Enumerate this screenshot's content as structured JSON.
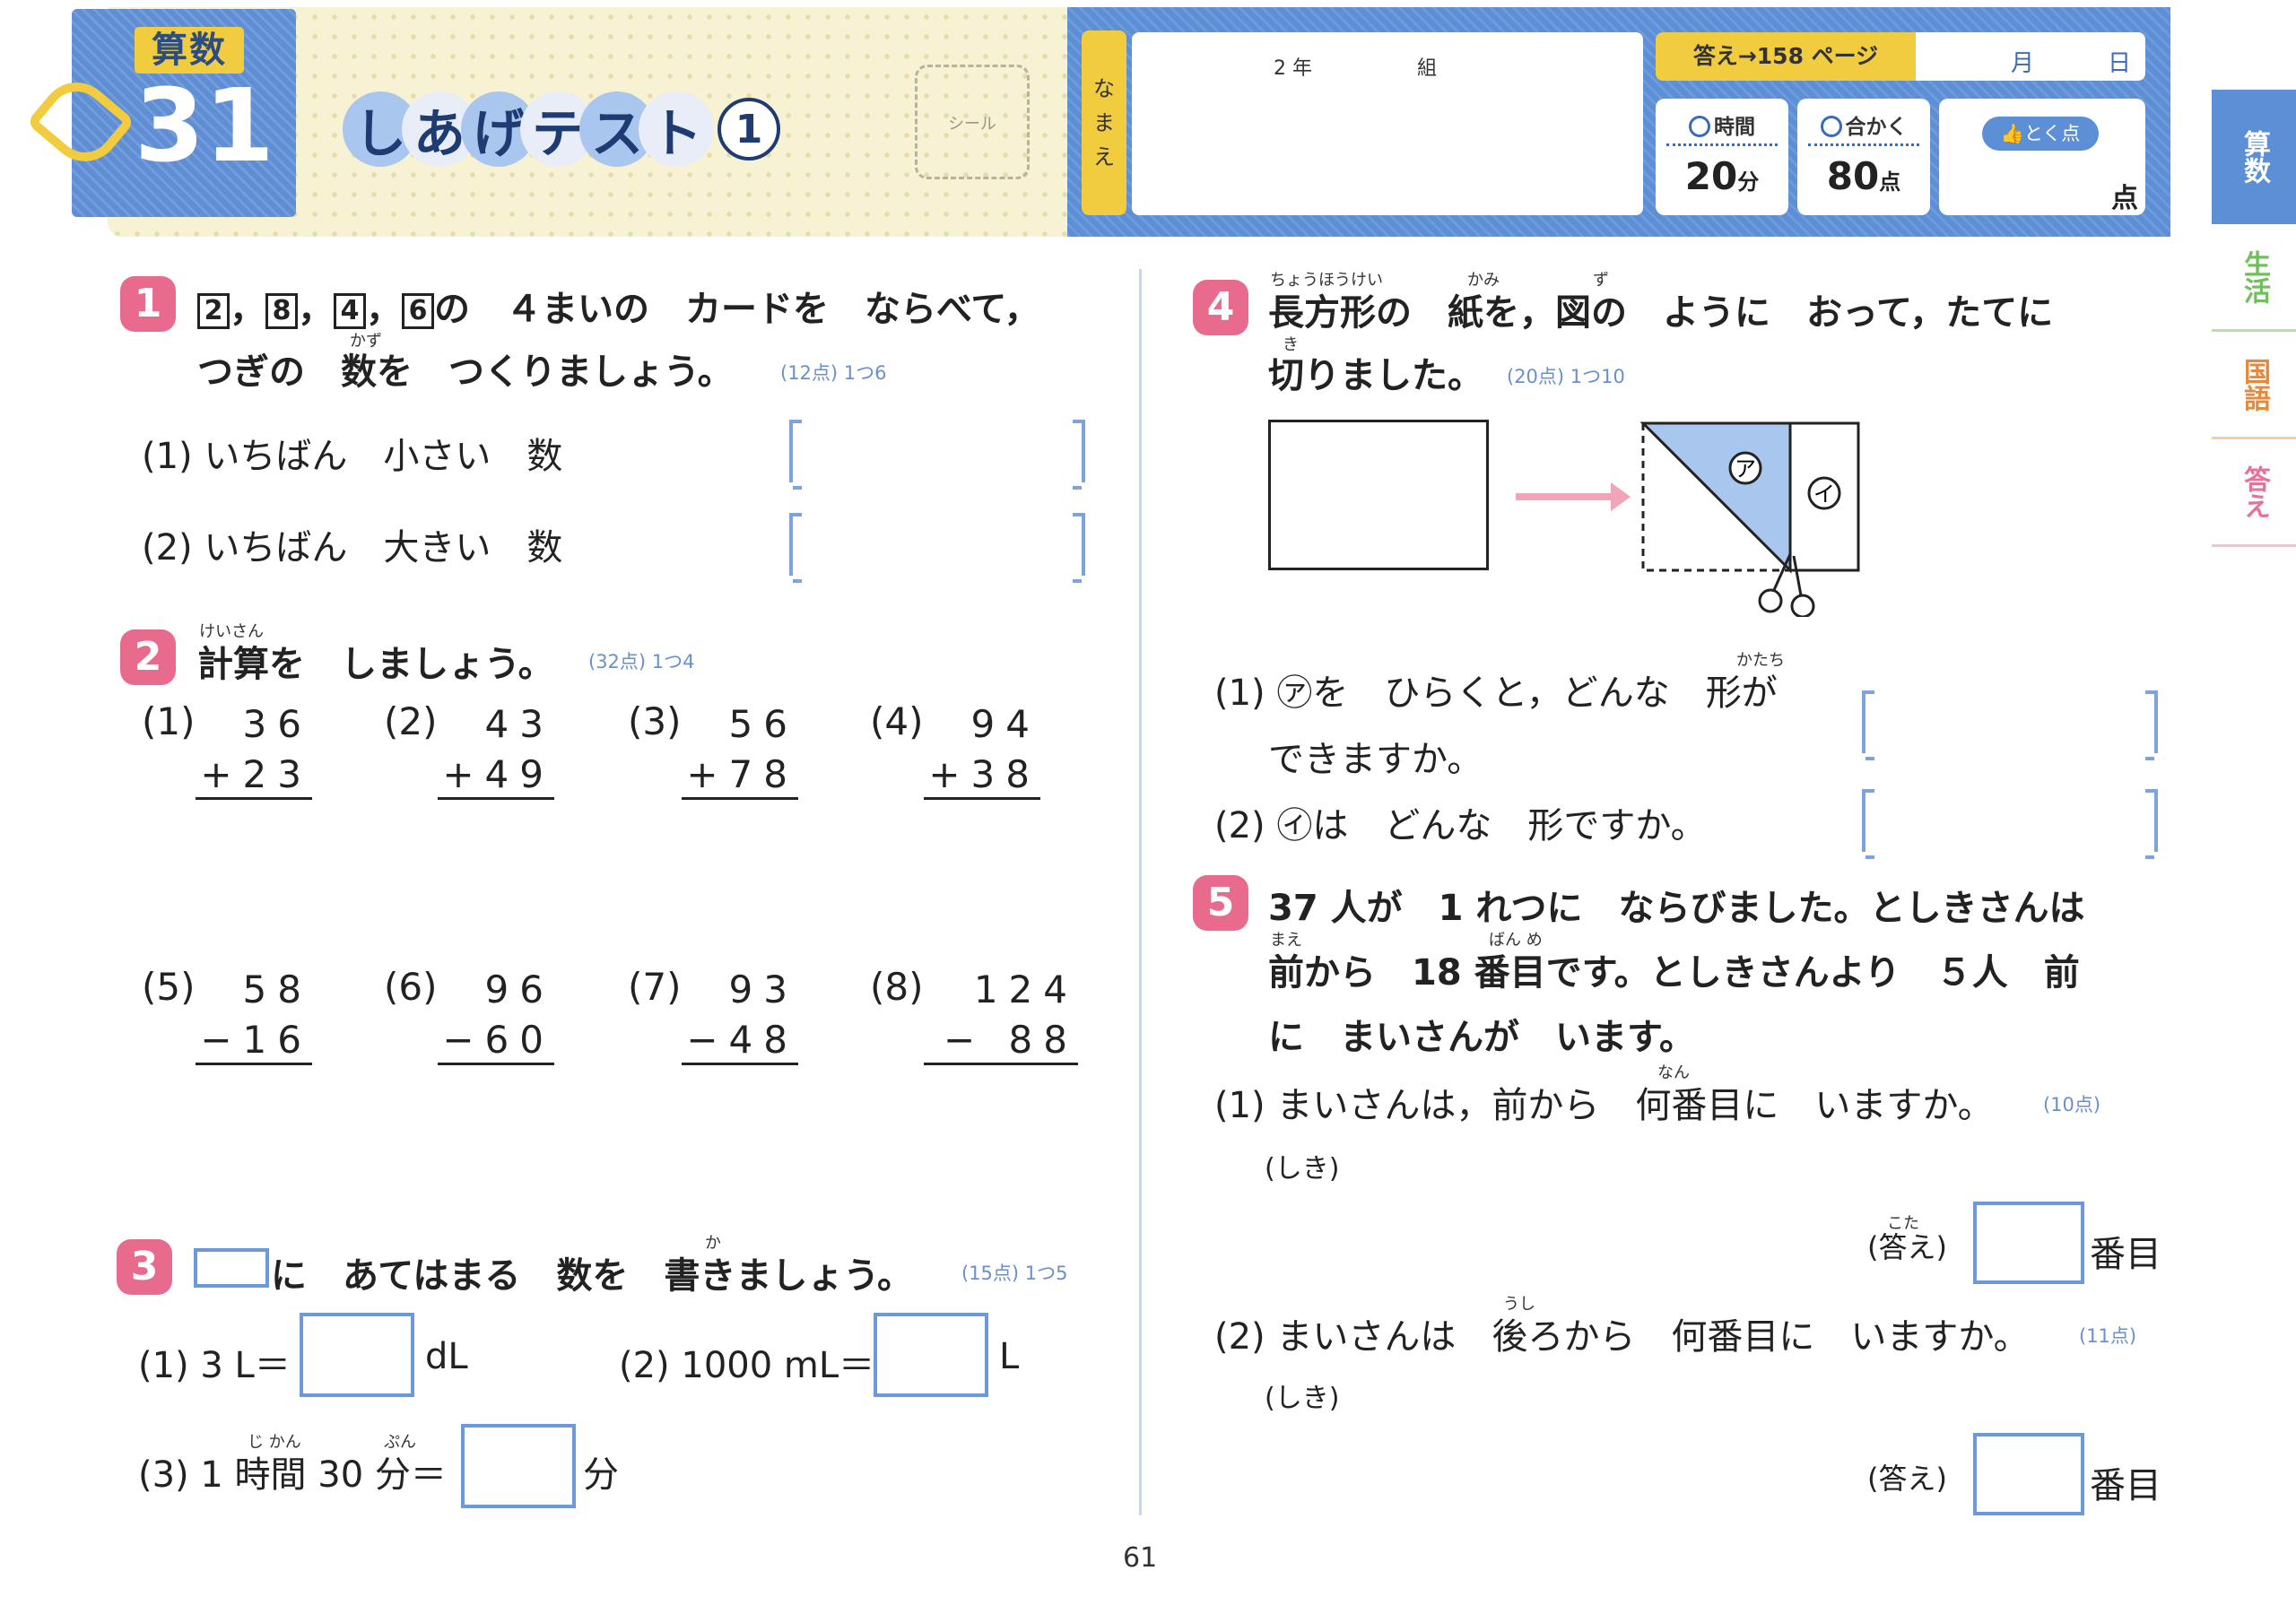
{
  "header": {
    "subject": "算数",
    "lesson_number": "31",
    "title_chars": [
      "し",
      "あ",
      "げ",
      "テ",
      "ス",
      "ト"
    ],
    "test_number": "1",
    "sticker_label": "シール",
    "name_label": [
      "な",
      "ま",
      "え"
    ],
    "grade": "2 年",
    "class": "組",
    "answer_ref": "答え→158 ページ",
    "month": "月",
    "day": "日",
    "time_label": "時間",
    "time_value": "20",
    "time_unit": "分",
    "pass_label": "合かく",
    "pass_value": "80",
    "pass_unit": "点",
    "score_label": "とく点",
    "score_unit": "点"
  },
  "side_tabs": [
    "算数",
    "生活",
    "国語",
    "答え"
  ],
  "q1": {
    "number": "1",
    "cards": [
      "2",
      "8",
      "4",
      "6"
    ],
    "line1_suffix": "の　４まいの　カードを　ならべて，",
    "line2": "つぎの　数を　つくりましょう。",
    "ruby_kazu": "かず",
    "points": "(12点) 1つ6",
    "parts": [
      {
        "label": "(1) いちばん　小さい　数"
      },
      {
        "label": "(2) いちばん　大きい　数"
      }
    ]
  },
  "q2": {
    "number": "2",
    "ruby": "けいさん",
    "text": "計算を　しましょう。",
    "points": "(32点) 1つ4",
    "problems": [
      {
        "label": "(1)",
        "a": "36",
        "b": "+23"
      },
      {
        "label": "(2)",
        "a": "43",
        "b": "+49"
      },
      {
        "label": "(3)",
        "a": "56",
        "b": "+78"
      },
      {
        "label": "(4)",
        "a": "94",
        "b": "+38"
      },
      {
        "label": "(5)",
        "a": "58",
        "b": "−16"
      },
      {
        "label": "(6)",
        "a": "96",
        "b": "−60"
      },
      {
        "label": "(7)",
        "a": "93",
        "b": "−48"
      },
      {
        "label": "(8)",
        "a": "124",
        "b": "− 88"
      }
    ]
  },
  "q3": {
    "number": "3",
    "text": "に　あてはまる　数を　書きましょう。",
    "ruby_ka": "か",
    "points": "(15点) 1つ5",
    "parts": [
      {
        "label": "(1) 3 L＝",
        "unit": "dL"
      },
      {
        "label": "(2) 1000 mL＝",
        "unit": "L"
      },
      {
        "label": "(3) 1 時間 30 分＝",
        "unit": "分"
      }
    ],
    "ruby_jikan": "じ かん",
    "ruby_fun": "ぷん"
  },
  "q4": {
    "number": "4",
    "ruby_chouhoukei": "ちょうほうけい",
    "ruby_kami": "かみ",
    "ruby_zu": "ず",
    "line1": "長方形の　紙を，図の　ように　おって，たてに",
    "ruby_ki": "き",
    "line2": "切りました。",
    "points": "(20点) 1つ10",
    "label_a": "ア",
    "label_i": "イ",
    "part1_line1": "(1) ㋐を　ひらくと，どんな　形が",
    "ruby_katachi": "かたち",
    "part1_line2": "できますか。",
    "part2": "(2) ㋑は　どんな　形ですか。"
  },
  "q5": {
    "number": "5",
    "line1": "37 人が　1 れつに　ならびました。としきさんは",
    "ruby_mae": "まえ",
    "ruby_ban": "ばん め",
    "line2": "前から　18 番目です。としきさんより　５人　前",
    "line3": "に　まいさんが　います。",
    "ruby_nan": "なん",
    "part1": "(1) まいさんは，前から　何番目に　いますか。",
    "part1_points": "(10点)",
    "shiki": "(しき)",
    "ruby_kotae": "こた",
    "answer_label": "(答え)",
    "answer_unit": "番目",
    "ruby_ushi": "うし",
    "part2": "(2) まいさんは　後ろから　何番目に　いますか。",
    "part2_points": "(11点)"
  },
  "page_number": "61"
}
